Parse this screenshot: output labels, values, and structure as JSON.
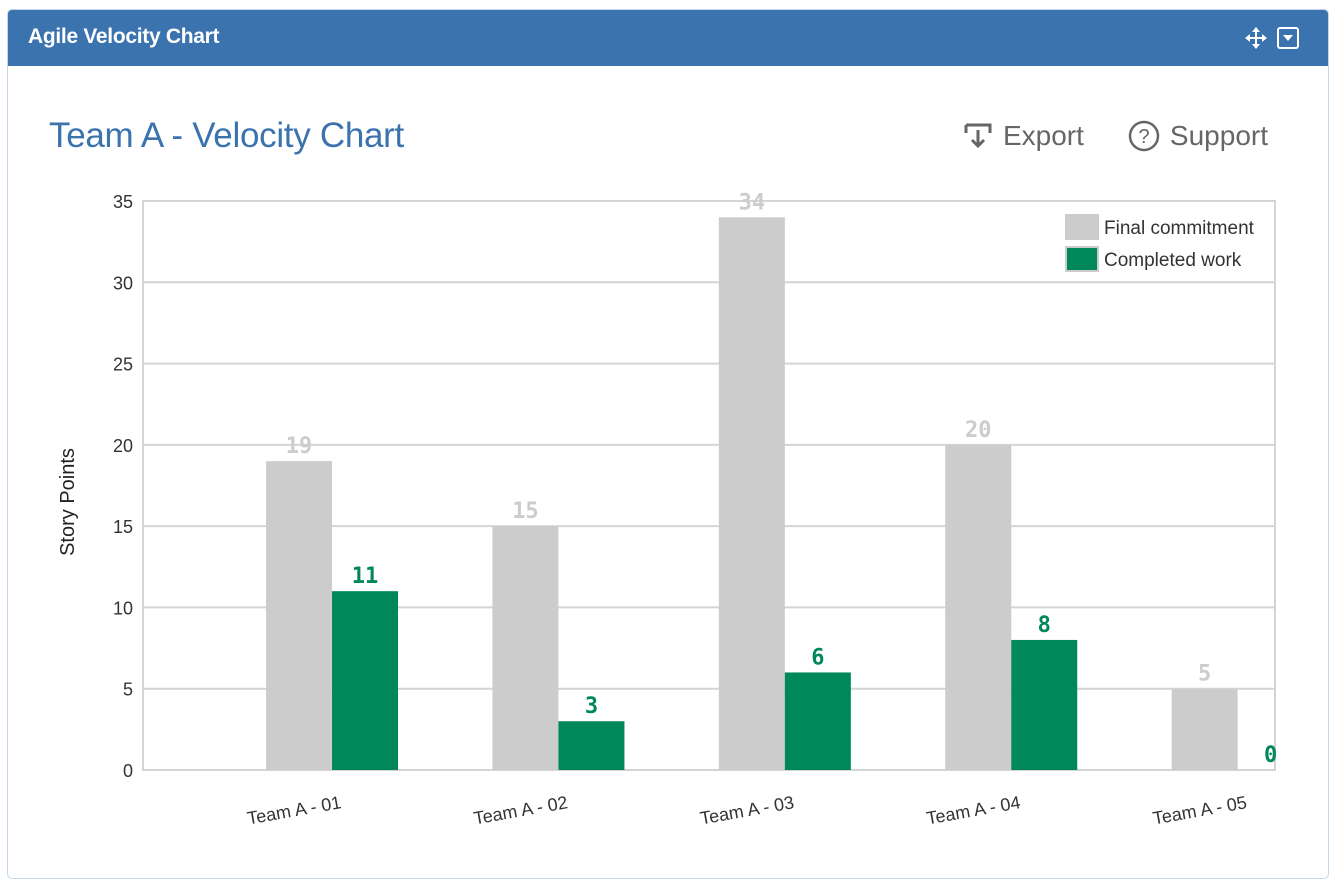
{
  "panel": {
    "title": "Agile Velocity Chart",
    "icons": [
      "move-icon",
      "collapse-dropdown-icon"
    ]
  },
  "header": {
    "title": "Team A - Velocity Chart",
    "actions": [
      {
        "label": "Export",
        "icon": "export-download-icon"
      },
      {
        "label": "Support",
        "icon": "help-circle-icon"
      }
    ]
  },
  "colors": {
    "header_bg": "#3b73ae",
    "title": "#3b73ae",
    "final_commitment": "#cccccc",
    "completed_work": "#00875a",
    "grid": "#d4d4d4"
  },
  "chart_data": {
    "type": "bar",
    "title": "Team A - Velocity Chart",
    "xlabel": "",
    "ylabel": "Story Points",
    "ylim": [
      0,
      35
    ],
    "yticks": [
      0,
      5,
      10,
      15,
      20,
      25,
      30,
      35
    ],
    "grid": true,
    "legend_position": "top-right",
    "categories": [
      "Team A - 01",
      "Team A - 02",
      "Team A - 03",
      "Team A - 04",
      "Team A - 05"
    ],
    "series": [
      {
        "name": "Final commitment",
        "color": "#cccccc",
        "label_color": "#cccccc",
        "values": [
          19,
          15,
          34,
          20,
          5
        ]
      },
      {
        "name": "Completed work",
        "color": "#00875a",
        "label_color": "#00875a",
        "values": [
          11,
          3,
          6,
          8,
          0
        ]
      }
    ]
  }
}
